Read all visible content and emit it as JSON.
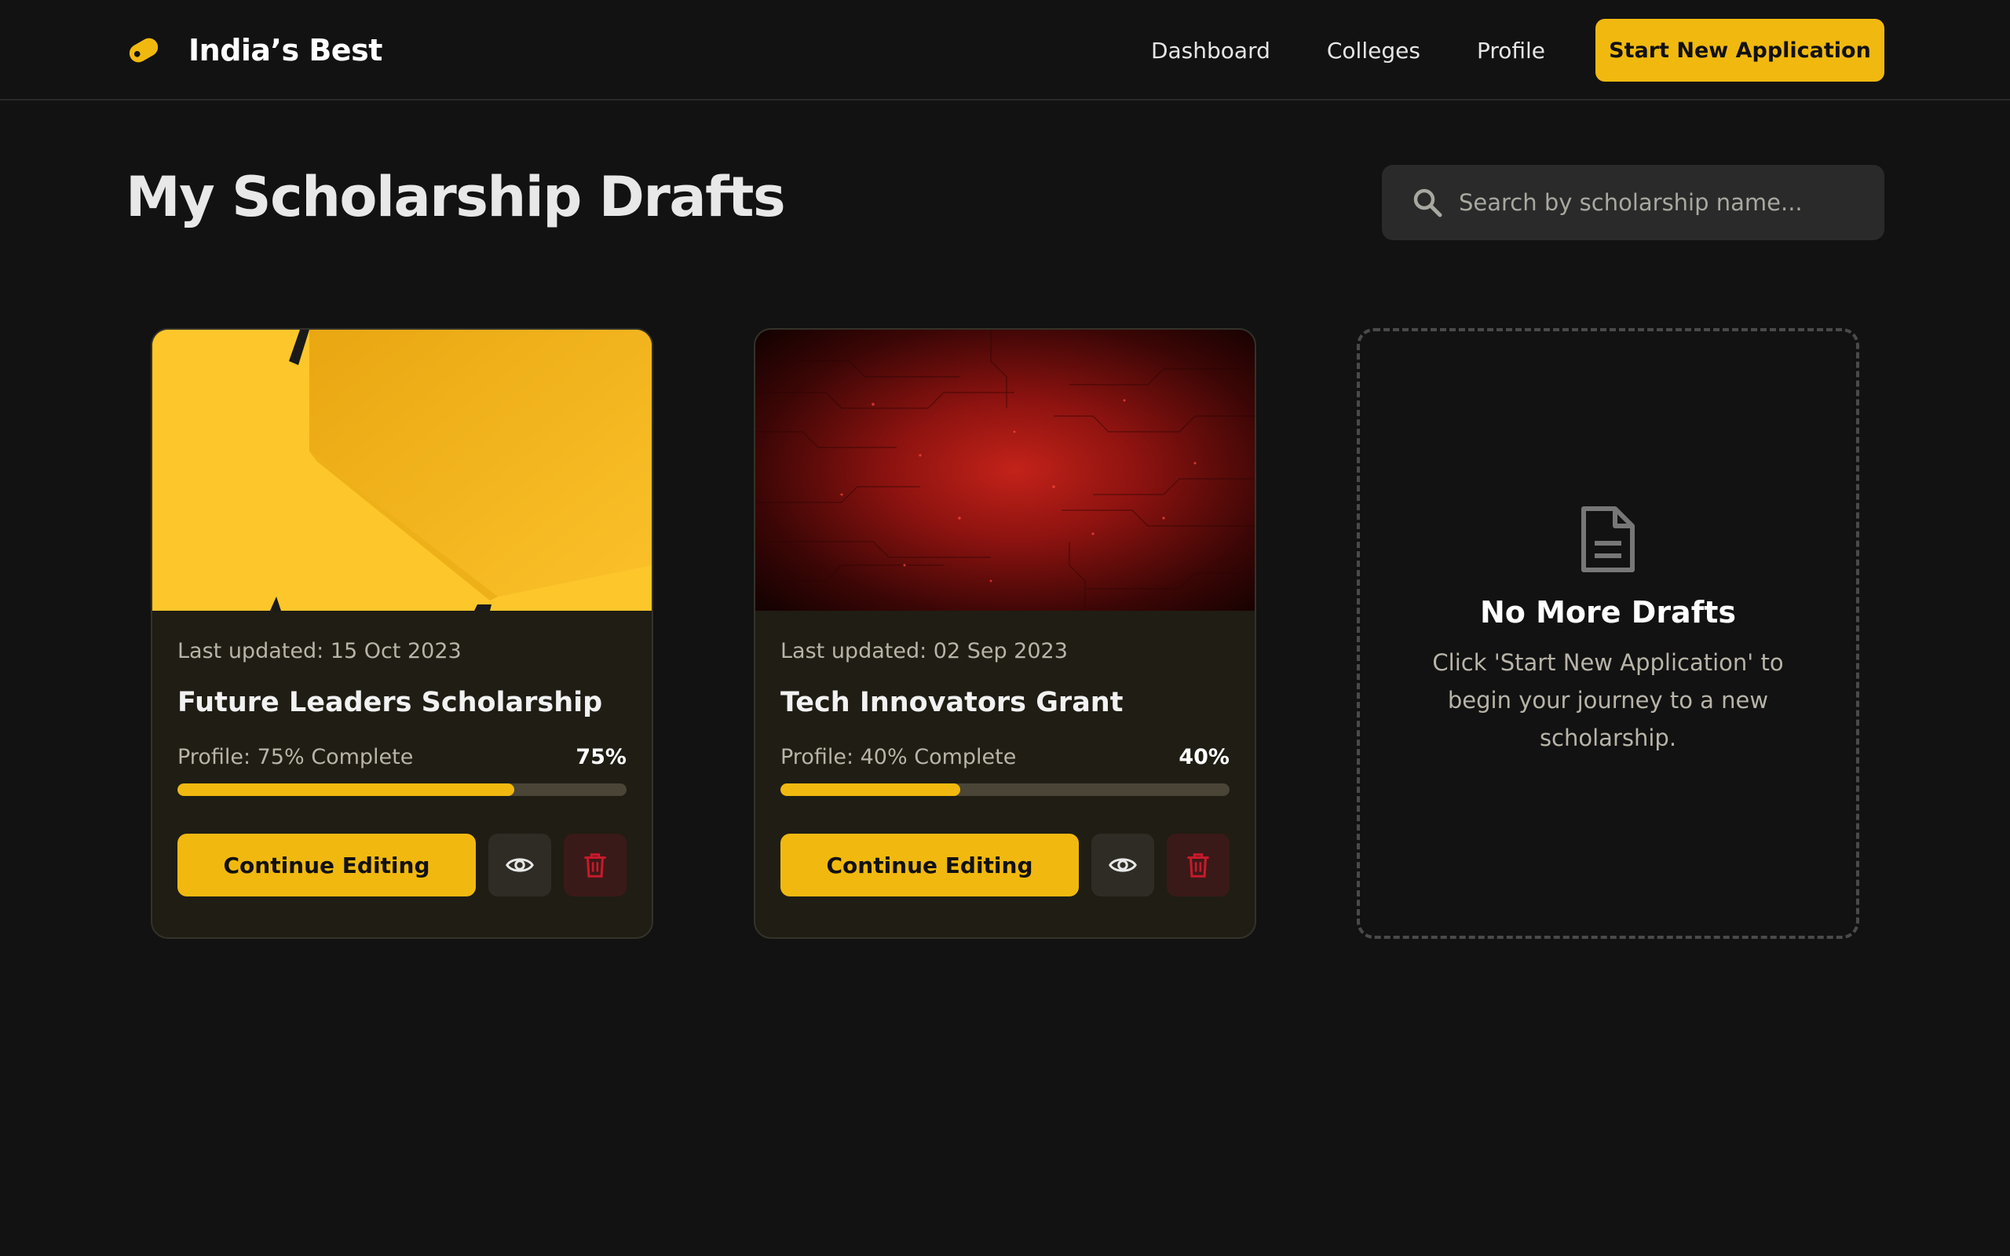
{
  "header": {
    "brand_name": "India’s Best",
    "nav": [
      "Dashboard",
      "Colleges",
      "Profile"
    ],
    "cta_label": "Start New Application"
  },
  "page": {
    "title": "My Scholarship Drafts",
    "search_placeholder": "Search by scholarship name..."
  },
  "drafts": [
    {
      "last_updated": "Last updated: 15 Oct 2023",
      "title": "Future Leaders Scholarship",
      "progress_label": "Profile: 75% Complete",
      "progress_percent_label": "75%",
      "progress": 0.75,
      "continue_label": "Continue Editing"
    },
    {
      "last_updated": "Last updated: 02 Sep 2023",
      "title": "Tech Innovators Grant",
      "progress_label": "Profile: 40% Complete",
      "progress_percent_label": "40%",
      "progress": 0.4,
      "continue_label": "Continue Editing"
    }
  ],
  "empty_state": {
    "title": "No More Drafts",
    "text": "Click 'Start New Application' to begin your journey to a new scholarship."
  },
  "colors": {
    "accent": "#f1b90f",
    "background": "#121212",
    "card": "#1f1d14",
    "danger": "#c8192b"
  },
  "icons": {
    "brand": "tag-icon",
    "search": "search-icon",
    "view": "eye-icon",
    "delete": "trash-icon",
    "empty": "document-icon"
  }
}
